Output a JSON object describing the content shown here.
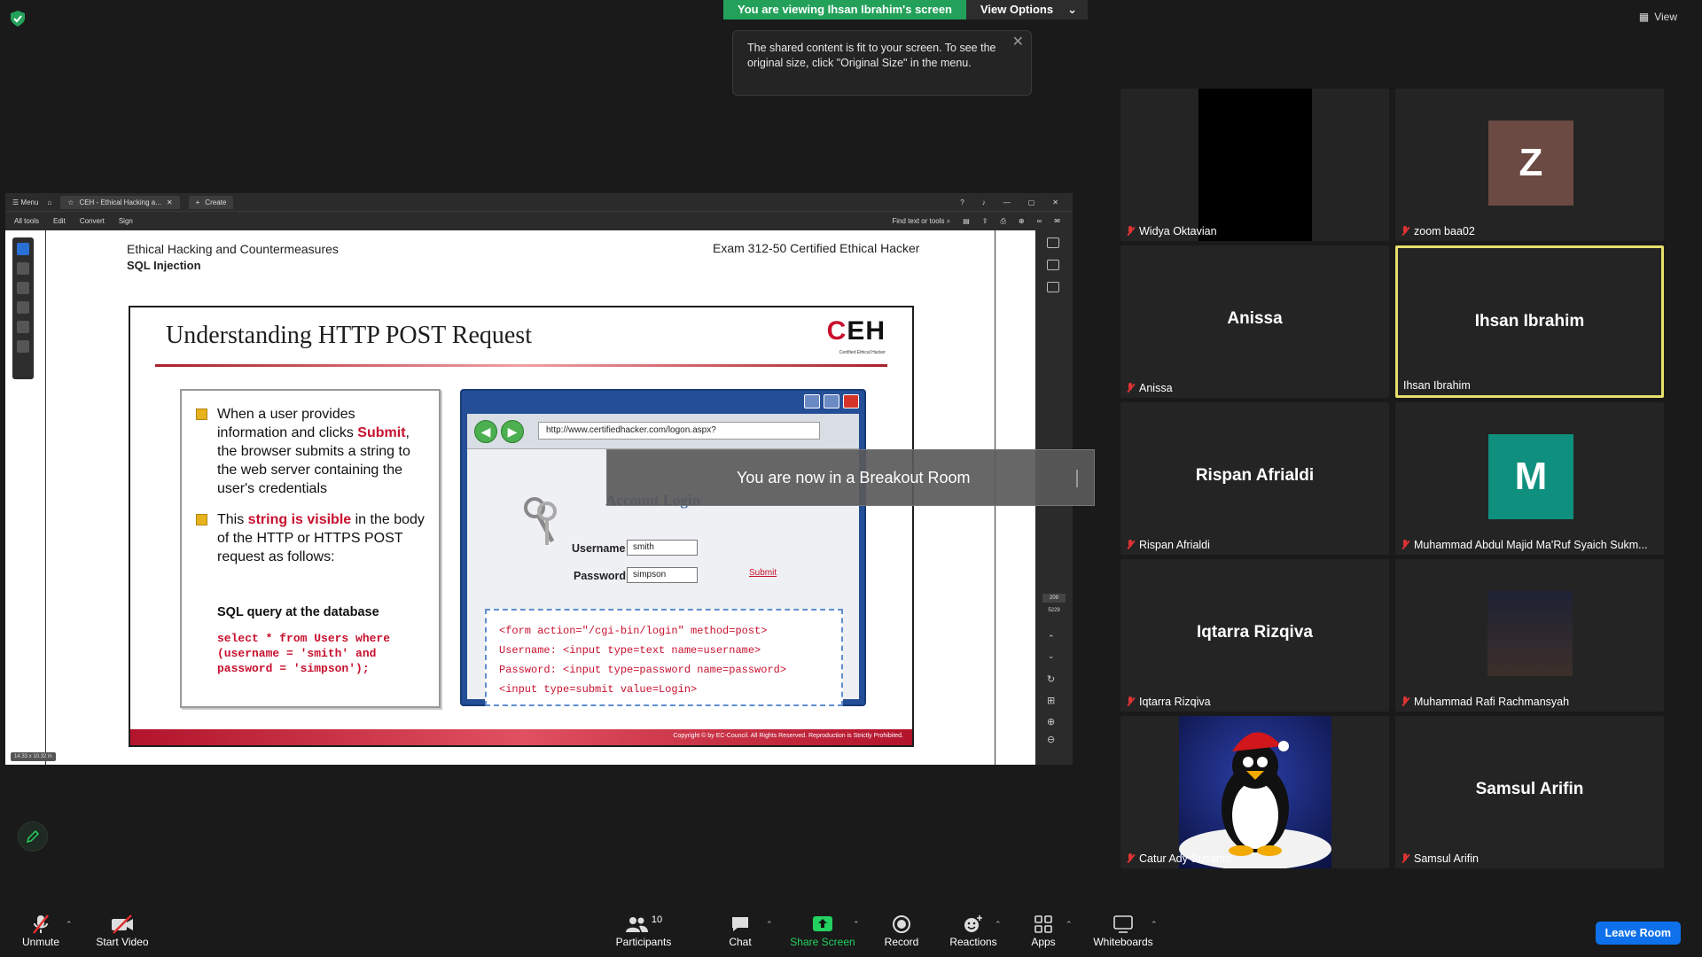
{
  "top": {
    "viewing_banner": "You are viewing Ihsan Ibrahim's screen",
    "view_options": "View Options",
    "view_label": "View",
    "tooltip_text": "The shared content is fit to your screen. To see the original size, click \"Original Size\" in the menu."
  },
  "acrobat": {
    "menu_label": "Menu",
    "tab_label": "CEH - Ethical Hacking a...",
    "create_label": "Create",
    "menubar": [
      "All tools",
      "Edit",
      "Convert",
      "Sign"
    ],
    "find_label": "Find text or tools",
    "page_num": "209",
    "page_total": "5229",
    "size_pill": "14.33 x 10.32 in"
  },
  "document": {
    "header_left_1": "Ethical Hacking and Countermeasures",
    "header_left_2": "SQL Injection",
    "header_right": "Exam 312-50 Certified Ethical Hacker",
    "slide_title": "Understanding HTTP POST Request",
    "logo_c": "C",
    "logo_eh": "EH",
    "logo_sub": "Certified   Ethical   Hacker",
    "bullet1_pre": "When a user provides information and clicks ",
    "bullet1_red": "Submit",
    "bullet1_post": ", the browser submits a string to the web server containing the user's credentials",
    "bullet2_pre": "This ",
    "bullet2_red": "string is visible",
    "bullet2_post": " in the body of the HTTP or HTTPS POST request as follows:",
    "sql_head": "SQL query at the database",
    "sql_line1": "select * from Users where",
    "sql_line2": "(username = 'smith' and",
    "sql_line3": "password = 'simpson');",
    "url": "http://www.certifiedhacker.com/logon.aspx?",
    "account_login": "Account Login",
    "username_label": "Username",
    "username_value": "smith",
    "password_label": "Password",
    "password_value": "simpson",
    "submit": "Submit",
    "code_line1": "<form action=\"/cgi-bin/login\" method=post>",
    "code_line2": "Username: <input type=text name=username>",
    "code_line3": "Password: <input type=password name=password>",
    "code_line4": "<input type=submit value=Login>",
    "footer": "Copyright © by EC-Council. All Rights Reserved. Reproduction is Strictly Prohibited."
  },
  "breakout_text": "You are now in a Breakout Room",
  "participants": [
    {
      "name": "Widya Oktavian",
      "kind": "video-black"
    },
    {
      "name": "zoom baa02",
      "kind": "avatar",
      "letter": "Z",
      "color": "#6b4a44"
    },
    {
      "name": "Anissa",
      "kind": "name"
    },
    {
      "name": "Ihsan Ibrahim",
      "kind": "name",
      "active": true
    },
    {
      "name": "Rispan Afrialdi",
      "kind": "name"
    },
    {
      "name": "Muhammad Abdul Majid Ma'Ruf Syaich Sukm...",
      "kind": "avatar",
      "letter": "M",
      "color": "#0f8f7e"
    },
    {
      "name": "Iqtarra Rizqiva",
      "kind": "name"
    },
    {
      "name": "Muhammad Rafi Rachmansyah",
      "kind": "photo"
    },
    {
      "name": "Catur Ady Susanto",
      "kind": "penguin"
    },
    {
      "name": "Samsul Arifin",
      "kind": "name"
    }
  ],
  "toolbar": {
    "unmute": "Unmute",
    "start_video": "Start Video",
    "participants": "Participants",
    "participants_count": "10",
    "chat": "Chat",
    "share_screen": "Share Screen",
    "record": "Record",
    "reactions": "Reactions",
    "apps": "Apps",
    "whiteboards": "Whiteboards",
    "leave": "Leave Room"
  }
}
